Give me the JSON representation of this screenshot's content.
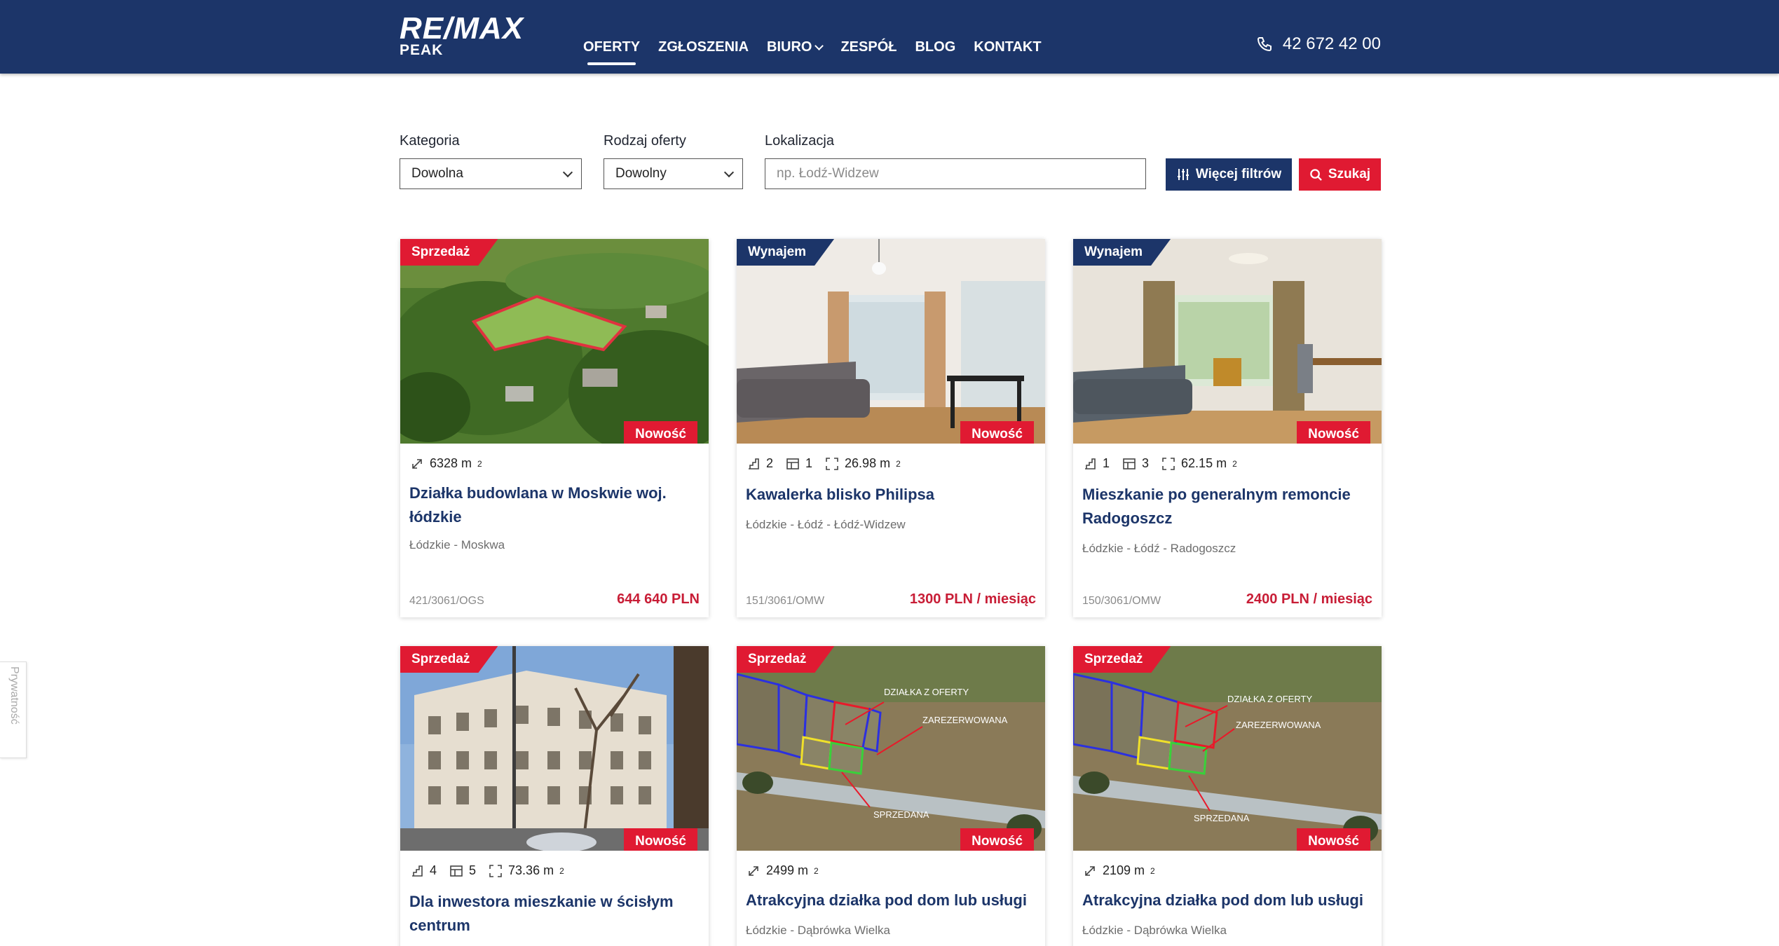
{
  "header": {
    "logo_line1": "RE/MAX",
    "logo_line2": "PEAK",
    "nav": [
      {
        "label": "OFERTY",
        "active": true
      },
      {
        "label": "ZGŁOSZENIA"
      },
      {
        "label": "BIURO",
        "dropdown": true
      },
      {
        "label": "ZESPÓŁ"
      },
      {
        "label": "BLOG"
      },
      {
        "label": "KONTAKT"
      }
    ],
    "phone": "42 672 42 00"
  },
  "filters": {
    "category_label": "Kategoria",
    "category_value": "Dowolna",
    "offer_type_label": "Rodzaj oferty",
    "offer_type_value": "Dowolny",
    "location_label": "Lokalizacja",
    "location_placeholder": "np. Łodź-Widzew",
    "more_filters_label": "Więcej filtrów",
    "search_label": "Szukaj"
  },
  "listings": [
    {
      "tag": "Sprzedaż",
      "badge": "Nowość",
      "area": "6328 m",
      "title": "Działka budowlana w Moskwie woj. łódzkie",
      "location": "Łódzkie - Moskwa",
      "ref": "421/3061/OGS",
      "price": "644 640 PLN"
    },
    {
      "tag": "Wynajem",
      "badge": "Nowość",
      "rooms": "2",
      "floor": "1",
      "area": "26.98 m",
      "title": "Kawalerka blisko Philipsa",
      "location": "Łódzkie - Łódź - Łódź-Widzew",
      "ref": "151/3061/OMW",
      "price": "1300 PLN / miesiąc"
    },
    {
      "tag": "Wynajem",
      "badge": "Nowość",
      "rooms": "1",
      "floor": "3",
      "area": "62.15 m",
      "title": "Mieszkanie po generalnym remoncie Radogoszcz",
      "location": "Łódzkie - Łódź - Radogoszcz",
      "ref": "150/3061/OMW",
      "price": "2400 PLN / miesiąc"
    },
    {
      "tag": "Sprzedaż",
      "badge": "Nowość",
      "rooms": "4",
      "floor": "5",
      "area": "73.36 m",
      "title": "Dla inwestora mieszkanie w ścisłym centrum"
    },
    {
      "tag": "Sprzedaż",
      "badge": "Nowość",
      "area": "2499 m",
      "title": "Atrakcyjna działka pod dom lub usługi",
      "location": "Łódzkie - Dąbrówka Wielka",
      "photo_labels": [
        "DZIAŁKA Z OFERTY",
        "ZAREZERWOWANA",
        "SPRZEDANA"
      ]
    },
    {
      "tag": "Sprzedaż",
      "badge": "Nowość",
      "area": "2109 m",
      "title": "Atrakcyjna działka pod dom lub usługi",
      "location": "Łódzkie - Dąbrówka Wielka",
      "photo_labels": [
        "DZIAŁKA Z OFERTY",
        "ZAREZERWOWANA",
        "SPRZEDANA"
      ]
    }
  ],
  "unit_sup": "2",
  "privacy_label": "Prywatność",
  "colors": {
    "navy": "#1c3569",
    "red": "#e01a32",
    "price": "#c81d36"
  }
}
